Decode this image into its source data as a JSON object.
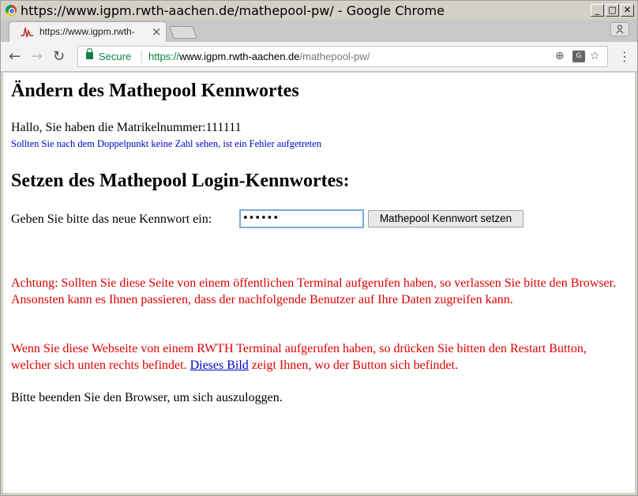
{
  "window": {
    "title": "https://www.igpm.rwth-aachen.de/mathepool-pw/ - Google Chrome",
    "min_glyph": "_",
    "max_glyph": "□",
    "close_glyph": "✕"
  },
  "tab": {
    "title": "https://www.igpm.rwth-",
    "close_glyph": "×"
  },
  "toolbar": {
    "back_glyph": "←",
    "forward_glyph": "→",
    "reload_glyph": "↻",
    "secure_label": "Secure",
    "url_scheme": "https://",
    "url_host": "www.igpm.rwth-aachen.de",
    "url_path": "/mathepool-pw/",
    "zoom_glyph": "⊕",
    "translate_glyph": "G",
    "star_glyph": "☆",
    "menu_glyph": "⋮"
  },
  "page": {
    "heading": "Ändern des Mathepool Kennwortes",
    "greeting": "Hallo, Sie haben die Matrikelnummer:111111",
    "note": "Sollten Sie nach dem Doppelpunkt keine Zahl sehen, ist ein Fehler aufgetreten",
    "subheading": "Setzen des Mathepool Login-Kennwortes:",
    "password_label": "Geben Sie bitte das neue Kennwort ein:",
    "password_value": "••••••",
    "submit_label": "Mathepool Kennwort setzen",
    "warning1": "Achtung: Sollten Sie diese Seite von einem öffentlichen Terminal aufgerufen haben, so verlassen Sie bitte den Browser. Ansonsten kann es Ihnen passieren, dass der nachfolgende Benutzer auf Ihre Daten zugreifen kann.",
    "warning2_before": "Wenn Sie diese Webseite von einem RWTH Terminal aufgerufen haben, so drücken Sie bitten den Restart Button, welcher sich unten rechts befindet. ",
    "warning2_link": "Dieses Bild",
    "warning2_after": " zeigt Ihnen, wo der Button sich befindet.",
    "goodbye": "Bitte beenden Sie den Browser, um sich auszuloggen."
  },
  "colors": {
    "secure_green": "#0b8043",
    "warning_red": "#dd0000",
    "note_blue": "#0000cc"
  }
}
